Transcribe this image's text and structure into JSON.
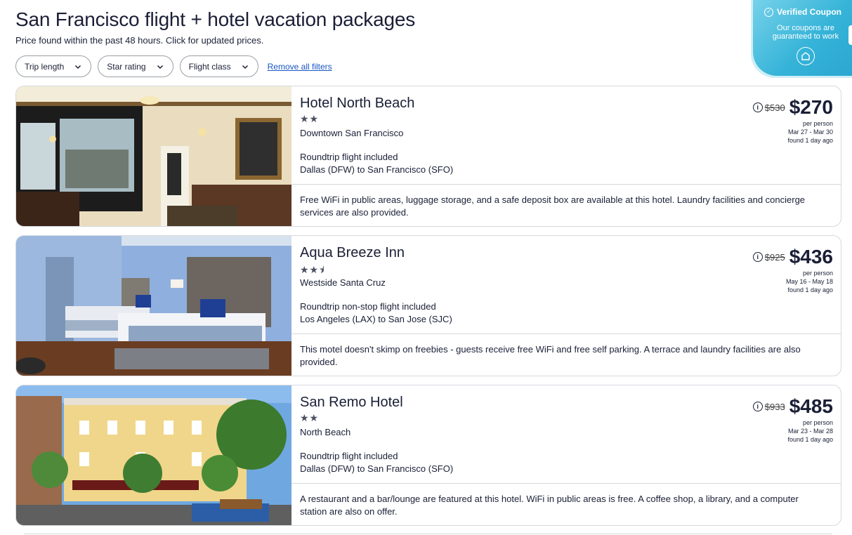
{
  "page": {
    "title": "San Francisco flight + hotel vacation packages",
    "subtitle": "Price found within the past 48 hours. Click for updated prices."
  },
  "filters": {
    "trip_length": "Trip length",
    "star_rating": "Star rating",
    "flight_class": "Flight class",
    "remove_all": "Remove all filters"
  },
  "coupon": {
    "title": "Verified Coupon",
    "text": "Our coupons are guaranteed to work",
    "accent": "#35b3d8"
  },
  "cards": [
    {
      "name": "Hotel North Beach",
      "stars": "★★",
      "star_rating": 2,
      "location": "Downtown San Francisco",
      "flight_line1": "Roundtrip flight included",
      "flight_line2": "Dallas (DFW) to San Francisco (SFO)",
      "description": "Free WiFi in public areas, luggage storage, and a safe deposit box are available at this hotel. Laundry facilities and concierge services are also provided.",
      "old_price": "$530",
      "price": "$270",
      "per": "per person",
      "dates": "Mar 27 - Mar 30",
      "found": "found 1 day ago"
    },
    {
      "name": "Aqua Breeze Inn",
      "stars": "★★⯨",
      "star_rating": 2.5,
      "location": "Westside Santa Cruz",
      "flight_line1": "Roundtrip non-stop flight included",
      "flight_line2": "Los Angeles (LAX) to San Jose (SJC)",
      "description": "This motel doesn't skimp on freebies - guests receive free WiFi and free self parking. A terrace and laundry facilities are also provided.",
      "old_price": "$925",
      "price": "$436",
      "per": "per person",
      "dates": "May 16 - May 18",
      "found": "found 1 day ago"
    },
    {
      "name": "San Remo Hotel",
      "stars": "★★",
      "star_rating": 2,
      "location": "North Beach",
      "flight_line1": "Roundtrip flight included",
      "flight_line2": "Dallas (DFW) to San Francisco (SFO)",
      "description": "A restaurant and a bar/lounge are featured at this hotel. WiFi in public areas is free. A coffee shop, a library, and a computer station are also on offer.",
      "old_price": "$933",
      "price": "$485",
      "per": "per person",
      "dates": "Mar 23 - Mar 28",
      "found": "found 1 day ago"
    }
  ]
}
